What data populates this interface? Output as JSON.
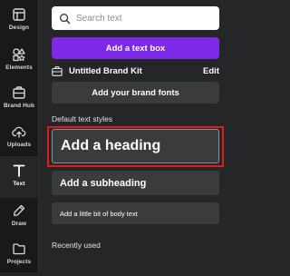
{
  "rail": {
    "items": [
      {
        "label": "Design",
        "icon": "design-icon",
        "active": false
      },
      {
        "label": "Elements",
        "icon": "elements-icon",
        "active": false
      },
      {
        "label": "Brand Hub",
        "icon": "brand-hub-icon",
        "active": false
      },
      {
        "label": "Uploads",
        "icon": "uploads-icon",
        "active": false
      },
      {
        "label": "Text",
        "icon": "text-icon",
        "active": true
      },
      {
        "label": "Draw",
        "icon": "draw-icon",
        "active": false
      },
      {
        "label": "Projects",
        "icon": "projects-icon",
        "active": false
      }
    ]
  },
  "panel": {
    "search": {
      "placeholder": "Search text",
      "value": ""
    },
    "add_text_box_label": "Add a text box",
    "brand_kit": {
      "name": "Untitled Brand Kit",
      "edit_label": "Edit"
    },
    "add_brand_fonts_label": "Add your brand fonts",
    "default_styles_title": "Default text styles",
    "styles": {
      "heading": "Add a heading",
      "subheading": "Add a subheading",
      "body": "Add a little bit of body text"
    },
    "recently_used_title": "Recently used"
  },
  "colors": {
    "panel_bg": "#252627",
    "rail_bg": "#18191b",
    "primary": "#7d2ae8",
    "secondary_bg": "#3a3b3d",
    "highlight": "#e01b1b"
  }
}
